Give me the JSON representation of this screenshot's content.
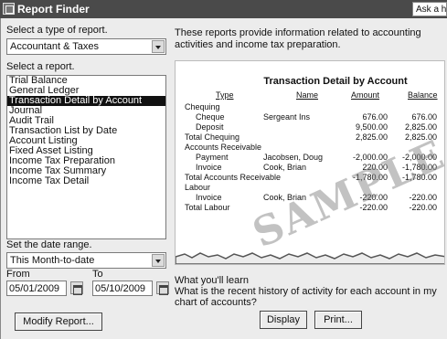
{
  "window": {
    "title": "Report Finder",
    "ask": "Ask a he"
  },
  "type_section": {
    "label": "Select a type of report.",
    "selected": "Accountant & Taxes"
  },
  "report_section": {
    "label": "Select a report.",
    "items": [
      "Trial Balance",
      "General Ledger",
      "Transaction Detail by Account",
      "Journal",
      "Audit Trail",
      "Transaction List by Date",
      "Account Listing",
      "Fixed Asset Listing",
      "Income Tax Preparation",
      "Income Tax Summary",
      "Income Tax Detail"
    ],
    "selected_index": 2
  },
  "date_section": {
    "label": "Set the date range.",
    "range": "This Month-to-date",
    "from_label": "From",
    "to_label": "To",
    "from": "05/01/2009",
    "to": "05/10/2009"
  },
  "description": "These reports provide information related to accounting activities and income tax preparation.",
  "preview": {
    "title": "Transaction Detail by Account",
    "headers": {
      "type": "Type",
      "name": "Name",
      "amount": "Amount",
      "balance": "Balance"
    },
    "watermark": "SAMPLE",
    "rows": [
      {
        "type": "Chequing",
        "indent": 0,
        "name": "",
        "amount": "",
        "balance": ""
      },
      {
        "type": "Cheque",
        "indent": 1,
        "name": "Sergeant Ins",
        "amount": "676.00",
        "balance": "676.00"
      },
      {
        "type": "Deposit",
        "indent": 1,
        "name": "",
        "amount": "9,500.00",
        "balance": "2,825.00"
      },
      {
        "type": "Total Chequing",
        "indent": 0,
        "name": "",
        "amount": "2,825.00",
        "balance": "2,825.00"
      },
      {
        "type": "Accounts Receivable",
        "indent": 0,
        "name": "",
        "amount": "",
        "balance": ""
      },
      {
        "type": "Payment",
        "indent": 1,
        "name": "Jacobsen, Doug",
        "amount": "-2,000.00",
        "balance": "-2,000.00"
      },
      {
        "type": "Invoice",
        "indent": 1,
        "name": "Cook, Brian",
        "amount": "220.00",
        "balance": "-1,780.00"
      },
      {
        "type": "Total Accounts Receivable",
        "indent": 0,
        "name": "",
        "amount": "-1,780.00",
        "balance": "-1,780.00"
      },
      {
        "type": "Labour",
        "indent": 0,
        "name": "",
        "amount": "",
        "balance": ""
      },
      {
        "type": "Invoice",
        "indent": 1,
        "name": "Cook, Brian",
        "amount": "-220.00",
        "balance": "-220.00"
      },
      {
        "type": "Total Labour",
        "indent": 0,
        "name": "",
        "amount": "-220.00",
        "balance": "-220.00"
      }
    ]
  },
  "learn": {
    "heading": "What you'll learn",
    "text": "What is the recent history of activity for each account in my chart of accounts?"
  },
  "buttons": {
    "modify": "Modify Report...",
    "display": "Display",
    "print": "Print..."
  }
}
